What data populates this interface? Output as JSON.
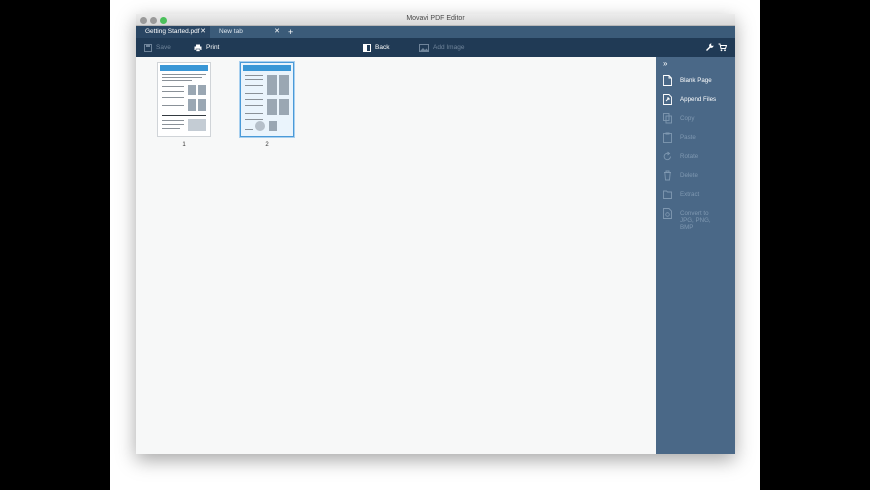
{
  "window": {
    "title": "Movavi PDF Editor"
  },
  "tabs": [
    {
      "label": "Getting Started.pdf",
      "close": "✕"
    },
    {
      "label": "New tab",
      "close": "✕"
    }
  ],
  "new_tab_symbol": "+",
  "toolbar": {
    "save_label": "Save",
    "print_label": "Print",
    "back_label": "Back",
    "add_image_label": "Add Image"
  },
  "pages": [
    {
      "number": "1"
    },
    {
      "number": "2"
    }
  ],
  "sidebar": {
    "collapse_symbol": "»",
    "items": [
      {
        "label": "Blank Page",
        "icon": "blank-page-icon",
        "enabled": true
      },
      {
        "label": "Append Files",
        "icon": "append-files-icon",
        "enabled": true
      },
      {
        "label": "Copy",
        "icon": "copy-icon",
        "enabled": false
      },
      {
        "label": "Paste",
        "icon": "paste-icon",
        "enabled": false
      },
      {
        "label": "Rotate",
        "icon": "rotate-icon",
        "enabled": false
      },
      {
        "label": "Delete",
        "icon": "delete-icon",
        "enabled": false
      },
      {
        "label": "Extract",
        "icon": "extract-icon",
        "enabled": false
      },
      {
        "label": "Convert to JPG, PNG, BMP",
        "icon": "convert-icon",
        "enabled": false
      }
    ]
  },
  "colors": {
    "tabbar": "#3b5b79",
    "toolbar": "#203a55",
    "sidepanel": "#4a6887",
    "canvas": "#f7f8f8",
    "accent": "#3a97d6"
  }
}
